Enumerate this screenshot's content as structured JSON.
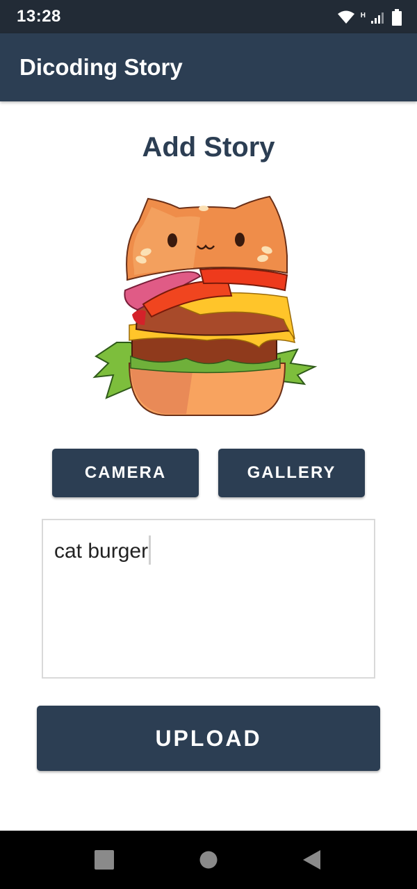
{
  "status_bar": {
    "time": "13:28",
    "network_type": "H",
    "icons": [
      "wifi-icon",
      "signal-icon",
      "battery-icon"
    ]
  },
  "app_bar": {
    "title": "Dicoding Story"
  },
  "page": {
    "title": "Add Story"
  },
  "preview_image": {
    "icon": "cat-burger-image"
  },
  "buttons": {
    "camera": "CAMERA",
    "gallery": "GALLERY",
    "upload": "UPLOAD"
  },
  "description_input": {
    "value": "cat burger"
  },
  "nav_bar": {
    "icons": [
      "recents-icon",
      "home-icon",
      "back-icon"
    ]
  },
  "colors": {
    "primary": "#2c3e53",
    "status_bar": "#222b36",
    "background": "#ffffff"
  }
}
